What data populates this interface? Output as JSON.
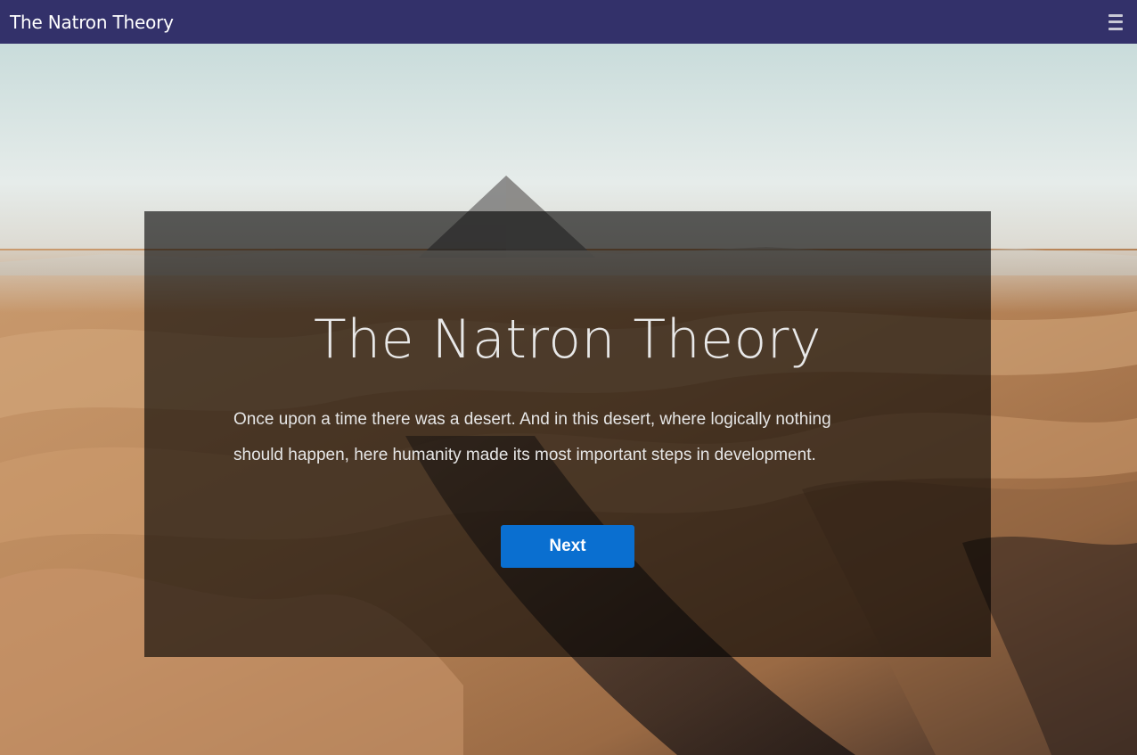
{
  "header": {
    "site_title": "The Natron Theory",
    "menu_icon": "hamburger-menu-icon",
    "background_color": "#33316a"
  },
  "hero": {
    "title": "The Natron Theory",
    "text": "Once upon a time there was a desert. And in this desert, where logically nothing should happen, here humanity made its most important steps in development.",
    "next_label": "Next",
    "button_color": "#0a6fd0"
  }
}
